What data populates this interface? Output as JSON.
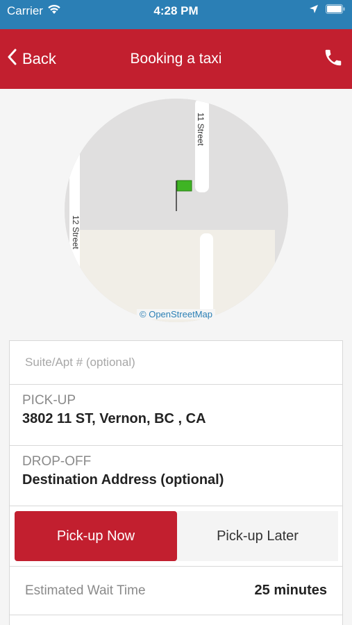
{
  "status_bar": {
    "carrier": "Carrier",
    "time": "4:28 PM"
  },
  "nav": {
    "back_label": "Back",
    "title": "Booking a taxi",
    "accent_color": "#c21f2f"
  },
  "map": {
    "street_labels": [
      "11 Street",
      "12 Street"
    ],
    "attribution": "© OpenStreetMap"
  },
  "form": {
    "suite_placeholder": "Suite/Apt # (optional)",
    "pickup_label": "PICK-UP",
    "pickup_value": "3802 11 ST, Vernon, BC , CA",
    "dropoff_label": "DROP-OFF",
    "dropoff_value": "Destination Address (optional)",
    "pickup_now": "Pick-up Now",
    "pickup_later": "Pick-up Later",
    "wait_label": "Estimated Wait Time",
    "wait_value": "25 minutes"
  }
}
